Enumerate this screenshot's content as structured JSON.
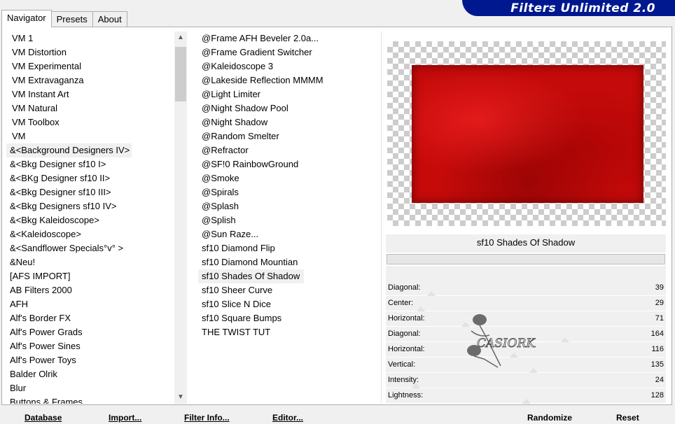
{
  "app": {
    "title": "Filters Unlimited 2.0"
  },
  "tabs": [
    {
      "label": "Navigator",
      "active": true
    },
    {
      "label": "Presets",
      "active": false
    },
    {
      "label": "About",
      "active": false
    }
  ],
  "categories": {
    "selected": "&<Background Designers IV>",
    "items": [
      "VM 1",
      "VM Distortion",
      "VM Experimental",
      "VM Extravaganza",
      "VM Instant Art",
      "VM Natural",
      "VM Toolbox",
      "VM",
      "&<Background Designers IV>",
      "&<Bkg Designer sf10 I>",
      "&<BKg Designer sf10 II>",
      "&<Bkg Designer sf10 III>",
      "&<Bkg Designers sf10 IV>",
      "&<Bkg Kaleidoscope>",
      "&<Kaleidoscope>",
      "&<Sandflower Specials°v° >",
      "&Neu!",
      "[AFS IMPORT]",
      "AB Filters 2000",
      "AFH",
      "Alf's Border FX",
      "Alf's Power Grads",
      "Alf's Power Sines",
      "Alf's Power Toys",
      "Balder Olrik",
      "Blur",
      "Buttons & Frames"
    ]
  },
  "filters": {
    "selected": "sf10 Shades Of Shadow",
    "items": [
      "@Frame AFH Beveler 2.0a...",
      "@Frame Gradient Switcher",
      "@Kaleidoscope 3",
      "@Lakeside Reflection MMMM",
      "@Light Limiter",
      "@Night Shadow Pool",
      "@Night Shadow",
      "@Random Smelter",
      "@Refractor",
      "@SF!0 RainbowGround",
      "@Smoke",
      "@Spirals",
      "@Splash",
      "@Splish",
      "@Sun Raze...",
      "sf10 Diamond Flip",
      "sf10 Diamond Mountian",
      "sf10 Shades Of Shadow",
      "sf10 Sheer Curve",
      "sf10 Slice N Dice",
      "sf10 Square Bumps",
      "THE TWIST TUT"
    ]
  },
  "preview": {
    "fill_color": "#c40a0a"
  },
  "selected_filter_name": "sf10 Shades Of Shadow",
  "params": [
    {
      "label": "Diagonal:",
      "value": 39
    },
    {
      "label": "Center:",
      "value": 29
    },
    {
      "label": "Horizontal:",
      "value": 71
    },
    {
      "label": "Diagonal:",
      "value": 164
    },
    {
      "label": "Horizontal:",
      "value": 116
    },
    {
      "label": "Vertical:",
      "value": 135
    },
    {
      "label": "Intensity:",
      "value": 24
    },
    {
      "label": "Lightness:",
      "value": 128
    }
  ],
  "watermark": {
    "text": "CASIORKE"
  },
  "buttons": {
    "database": "Database",
    "import": "Import...",
    "filter_info": "Filter Info...",
    "editor": "Editor...",
    "randomize": "Randomize",
    "reset": "Reset"
  },
  "colors": {
    "banner": "#00188f",
    "accent_red": "#c40a0a"
  }
}
